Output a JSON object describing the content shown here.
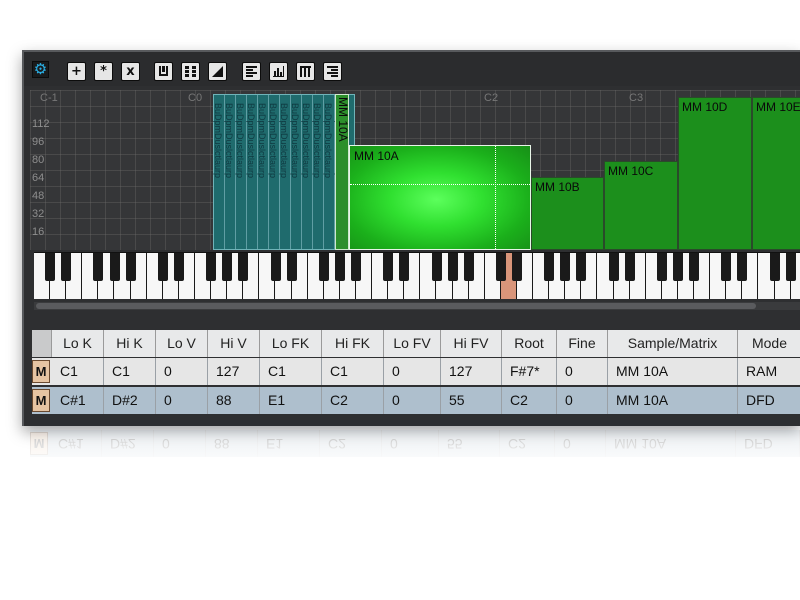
{
  "toolbar": {
    "settings_icon": "gear-icon",
    "buttons": [
      {
        "name": "add-zone-button",
        "label": "+"
      },
      {
        "name": "duplicate-zone-button",
        "label": "*"
      },
      {
        "name": "delete-zone-button",
        "label": "x"
      }
    ],
    "icons": [
      "single-key-icon",
      "grid-layout-icon",
      "velocity-ramp-icon",
      "align-left-icon",
      "bars-icon",
      "keys-icon",
      "align-right-icon"
    ]
  },
  "map": {
    "octave_labels": [
      "C-1",
      "C0",
      "C2",
      "C3"
    ],
    "velocity_labels": [
      "112",
      "96",
      "80",
      "64",
      "48",
      "32",
      "16"
    ],
    "strips_text": "BuDpmDuslctlaurp",
    "zones": {
      "z1": "MM 10A",
      "z2": "MM 10A",
      "z3": "MM 10B",
      "z4": "MM 10C",
      "z5": "MM 10D",
      "z6": "MM 10E"
    },
    "colors": {
      "selected": "#3ef03e",
      "zone": "#1c8f1c",
      "strip": "#1e6a6c",
      "highlight_key": "#d9957a"
    }
  },
  "table": {
    "headers": [
      "Lo K",
      "Hi K",
      "Lo V",
      "Hi V",
      "Lo FK",
      "Hi FK",
      "Lo FV",
      "Hi FV",
      "Root",
      "Fine",
      "Sample/Matrix",
      "Mode"
    ],
    "rows": [
      {
        "mute": "M",
        "cells": [
          "C1",
          "C1",
          "0",
          "127",
          "C1",
          "C1",
          "0",
          "127",
          "F#7*",
          "0",
          "MM 10A",
          "RAM"
        ]
      },
      {
        "mute": "M",
        "cells": [
          "C#1",
          "D#2",
          "0",
          "88",
          "E1",
          "C2",
          "0",
          "55",
          "C2",
          "0",
          "MM 10A",
          "DFD"
        ]
      }
    ]
  }
}
